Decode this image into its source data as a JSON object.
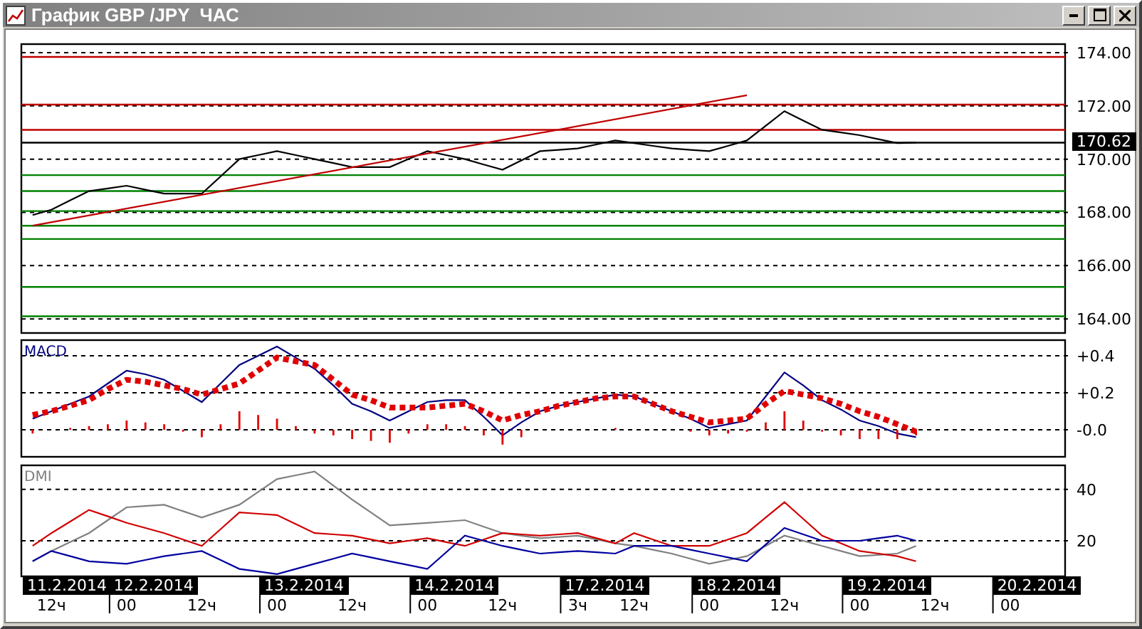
{
  "window": {
    "title": "График GBP /JPY  ЧАС",
    "buttons": [
      {
        "kind": "minimize"
      },
      {
        "kind": "maximize"
      },
      {
        "kind": "close"
      }
    ]
  },
  "charts": [
    {
      "kind": "price",
      "chart_data": {
        "type": "line",
        "grid": true,
        "categories": [
          null,
          null,
          null,
          null,
          null,
          null,
          null,
          null,
          null,
          null,
          null,
          null,
          null,
          null,
          null,
          null,
          null,
          null,
          null,
          null,
          null,
          null,
          null,
          null,
          null,
          null,
          null,
          null,
          null,
          null,
          null,
          null,
          null,
          null,
          null,
          null,
          null,
          null,
          null,
          null,
          null,
          null,
          null,
          null,
          null,
          null,
          null,
          null,
          null,
          null,
          null,
          null,
          null
        ],
        "series": [
          {
            "color": "#000000",
            "values": [
              167.9,
              168.1,
              168.45,
              168.8,
              168.9,
              169.0,
              168.85,
              168.7,
              168.7,
              168.7,
              169.35,
              170.0,
              170.15,
              170.3,
              170.15,
              170.0,
              169.85,
              169.7,
              169.7,
              169.7,
              170.0,
              170.3,
              170.15,
              170.0,
              169.8,
              169.6,
              169.95,
              170.3,
              170.35,
              170.4,
              170.55,
              170.7,
              170.6,
              170.5,
              170.4,
              170.35,
              170.3,
              170.5,
              170.7,
              171.25,
              171.8,
              171.45,
              171.1,
              171.0,
              170.9,
              170.75,
              170.6,
              170.62,
              null,
              null,
              null,
              null,
              null
            ]
          },
          {
            "color": "#c00000",
            "values": [
              167.5,
              null,
              null,
              null,
              null,
              null,
              null,
              null,
              null,
              null,
              null,
              null,
              null,
              null,
              null,
              null,
              null,
              null,
              null,
              null,
              null,
              null,
              null,
              null,
              null,
              null,
              null,
              null,
              null,
              null,
              null,
              null,
              null,
              null,
              null,
              null,
              null,
              null,
              172.4,
              null,
              null,
              null,
              null,
              null,
              null,
              null,
              null,
              null,
              null,
              null,
              null,
              null,
              null
            ]
          }
        ],
        "ylim": [
          163.47,
          174.32
        ],
        "yticks": [
          {
            "value": 164,
            "label": "164.00"
          },
          {
            "value": 166,
            "label": "166.00"
          },
          {
            "value": 168,
            "label": "168.00"
          },
          {
            "value": 170,
            "label": "170.00"
          },
          {
            "value": 172,
            "label": "172.00"
          },
          {
            "value": 174,
            "label": "174.00"
          }
        ],
        "ref_lines": [
          {
            "axis": "y",
            "value": 173.84,
            "color": "#c00000"
          },
          {
            "axis": "y",
            "value": 172.05,
            "color": "#c00000"
          },
          {
            "axis": "y",
            "value": 171.1,
            "color": "#c00000"
          },
          {
            "axis": "y",
            "value": 170.62,
            "color": "#000000"
          },
          {
            "axis": "y",
            "value": 169.4,
            "color": "#008000"
          },
          {
            "axis": "y",
            "value": 168.8,
            "color": "#008000"
          },
          {
            "axis": "y",
            "value": 168.05,
            "color": "#008000"
          },
          {
            "axis": "y",
            "value": 167.5,
            "color": "#008000"
          },
          {
            "axis": "y",
            "value": 167.0,
            "color": "#008000"
          },
          {
            "axis": "y",
            "value": 165.2,
            "color": "#008000"
          },
          {
            "axis": "y",
            "value": 164.1,
            "color": "#008000"
          }
        ],
        "annotations": [
          "170.62"
        ]
      }
    },
    {
      "kind": "macd",
      "chart_data": {
        "type": "line",
        "title": "MACD",
        "grid": true,
        "categories": [
          null,
          null,
          null,
          null,
          null,
          null,
          null,
          null,
          null,
          null,
          null,
          null,
          null,
          null,
          null,
          null,
          null,
          null,
          null,
          null,
          null,
          null,
          null,
          null,
          null,
          null,
          null,
          null,
          null,
          null,
          null,
          null,
          null,
          null,
          null,
          null,
          null,
          null,
          null,
          null,
          null,
          null,
          null,
          null,
          null,
          null,
          null,
          null,
          null,
          null,
          null,
          null,
          null
        ],
        "series": [
          {
            "color": "#000080",
            "values": [
              0.06,
              0.1,
              0.14,
              0.18,
              0.25,
              0.32,
              0.3,
              0.27,
              0.21,
              0.15,
              0.25,
              0.35,
              0.4,
              0.45,
              0.39,
              0.33,
              0.24,
              0.14,
              0.1,
              0.05,
              0.1,
              0.15,
              0.16,
              0.16,
              0.07,
              -0.03,
              0.04,
              0.1,
              0.13,
              0.15,
              0.17,
              0.19,
              0.18,
              0.14,
              0.1,
              0.06,
              0.01,
              0.03,
              0.05,
              0.18,
              0.31,
              0.24,
              0.16,
              0.11,
              0.05,
              0.02,
              -0.02,
              -0.04,
              null,
              null,
              null,
              null,
              null
            ]
          },
          {
            "color": "#e00000",
            "line_style": "dotted",
            "values": [
              0.08,
              0.1,
              0.13,
              0.16,
              0.22,
              0.27,
              0.26,
              0.24,
              0.22,
              0.19,
              0.22,
              0.25,
              0.32,
              0.39,
              0.37,
              0.35,
              0.27,
              0.19,
              0.16,
              0.12,
              0.12,
              0.12,
              0.13,
              0.14,
              0.1,
              0.05,
              0.08,
              0.1,
              0.13,
              0.15,
              0.17,
              0.18,
              0.18,
              0.14,
              0.1,
              0.07,
              0.04,
              0.05,
              0.06,
              0.14,
              0.21,
              0.19,
              0.17,
              0.14,
              0.1,
              0.07,
              0.03,
              -0.01,
              null,
              null,
              null,
              null,
              null
            ]
          },
          {
            "color": "#e00000",
            "type": "bar",
            "values": [
              -0.02,
              0,
              0.01,
              0.02,
              0.03,
              0.05,
              0.04,
              0.03,
              -0.01,
              -0.04,
              0.03,
              0.1,
              0.08,
              0.06,
              0.02,
              -0.02,
              -0.03,
              -0.05,
              -0.06,
              -0.07,
              -0.02,
              0.03,
              0.03,
              0.02,
              -0.03,
              -0.08,
              -0.04,
              0,
              0,
              0,
              0,
              0.01,
              0,
              0,
              0,
              -0.01,
              -0.03,
              -0.02,
              -0.01,
              0.04,
              0.1,
              0.05,
              -0.01,
              -0.03,
              -0.05,
              -0.05,
              -0.05,
              -0.03,
              null,
              null,
              null,
              null,
              null
            ]
          }
        ],
        "ylim": [
          -0.146,
          0.485
        ],
        "yticks": [
          {
            "value": 0,
            "label": "-0.0"
          },
          {
            "value": 0.2,
            "label": "+0.2"
          },
          {
            "value": 0.4,
            "label": "+0.4"
          }
        ]
      }
    },
    {
      "kind": "dmi",
      "date_labels": [
        {
          "text": "11.2.2014"
        },
        {
          "text": "12.2.2014"
        },
        {
          "text": "13.2.2014"
        },
        {
          "text": "14.2.2014"
        },
        {
          "text": "17.2.2014"
        },
        {
          "text": "18.2.2014"
        },
        {
          "text": "19.2.2014"
        },
        {
          "text": "20.2.2014"
        }
      ],
      "chart_data": {
        "type": "line",
        "title": "DMI",
        "grid": true,
        "categories": [
          null,
          "12ч",
          null,
          null,
          null,
          "00",
          null,
          null,
          null,
          "12ч",
          null,
          null,
          null,
          "00",
          null,
          null,
          null,
          "12ч",
          null,
          null,
          null,
          "00",
          null,
          null,
          null,
          "12ч",
          null,
          null,
          null,
          "3ч",
          null,
          null,
          "12ч",
          null,
          null,
          null,
          "00",
          null,
          null,
          null,
          "12ч",
          null,
          null,
          null,
          "00",
          null,
          null,
          null,
          "12ч",
          null,
          null,
          null,
          "00"
        ],
        "series": [
          {
            "color": "#808080",
            "values": [
              12,
              16,
              19.5,
              23,
              28,
              33,
              33.5,
              34,
              31.5,
              29,
              31.5,
              34,
              39,
              44,
              45.5,
              47,
              41.5,
              36,
              31,
              26,
              26.5,
              27,
              27.5,
              28,
              25.5,
              23,
              22,
              21,
              21.5,
              22,
              20.5,
              19,
              18,
              16.5,
              15,
              13,
              11,
              12.5,
              14,
              18,
              22,
              20,
              18,
              16,
              14,
              14.5,
              15,
              18,
              null,
              null,
              null,
              null,
              null
            ]
          },
          {
            "color": "#d00000",
            "values": [
              18,
              23,
              27.5,
              32,
              29.5,
              27,
              25,
              23,
              20.5,
              18,
              24.5,
              31,
              30.5,
              30,
              26.5,
              23,
              22.5,
              22,
              20.5,
              19,
              20,
              21,
              19.5,
              18,
              20.5,
              23,
              22.5,
              22,
              22.5,
              23,
              21,
              19,
              23,
              20.5,
              18,
              18,
              18,
              20.5,
              23,
              29,
              35,
              28.5,
              22,
              19,
              16,
              15,
              14,
              12,
              null,
              null,
              null,
              null,
              null
            ]
          },
          {
            "color": "#0000a0",
            "values": [
              12,
              16,
              14,
              12,
              11.5,
              11,
              12.5,
              14,
              15,
              16,
              12.5,
              9,
              8,
              7,
              9,
              11,
              13,
              15,
              13.5,
              12,
              10.5,
              9,
              15.5,
              22,
              20,
              18,
              16.5,
              15,
              15.5,
              16,
              15.5,
              15,
              18,
              18,
              18,
              16.5,
              15,
              13.5,
              12,
              18.5,
              25,
              22.5,
              20,
              20,
              20,
              21,
              22,
              20,
              null,
              null,
              null,
              null,
              null
            ]
          }
        ],
        "ylim": [
          6.1,
          49.4
        ],
        "yticks": [
          {
            "value": 20,
            "label": "20"
          },
          {
            "value": 40,
            "label": "40"
          }
        ]
      }
    }
  ]
}
